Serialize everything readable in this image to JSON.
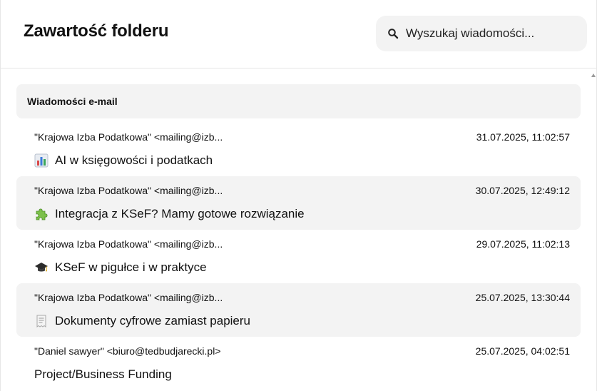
{
  "header": {
    "title": "Zawartość folderu",
    "search_placeholder": "Wyszukaj wiadomości..."
  },
  "section": {
    "title": "Wiadomości e-mail"
  },
  "emails": [
    {
      "sender": "\"Krajowa Izba Podatkowa\" <mailing@izb...",
      "date": "31.07.2025, 11:02:57",
      "subject": "AI w księgowości i podatkach",
      "icon": "bar-chart-icon"
    },
    {
      "sender": "\"Krajowa Izba Podatkowa\" <mailing@izb...",
      "date": "30.07.2025, 12:49:12",
      "subject": "Integracja z KSeF? Mamy gotowe rozwiązanie",
      "icon": "puzzle-icon"
    },
    {
      "sender": "\"Krajowa Izba Podatkowa\" <mailing@izb...",
      "date": "29.07.2025, 11:02:13",
      "subject": "KSeF w pigułce i w praktyce",
      "icon": "graduation-cap-icon"
    },
    {
      "sender": "\"Krajowa Izba Podatkowa\" <mailing@izb...",
      "date": "25.07.2025, 13:30:44",
      "subject": "Dokumenty cyfrowe zamiast papieru",
      "icon": "receipt-icon"
    },
    {
      "sender": "\"Daniel sawyer\" <biuro@tedbudjarecki.pl>",
      "date": "25.07.2025, 04:02:51",
      "subject": "Project/Business Funding",
      "icon": ""
    }
  ]
}
